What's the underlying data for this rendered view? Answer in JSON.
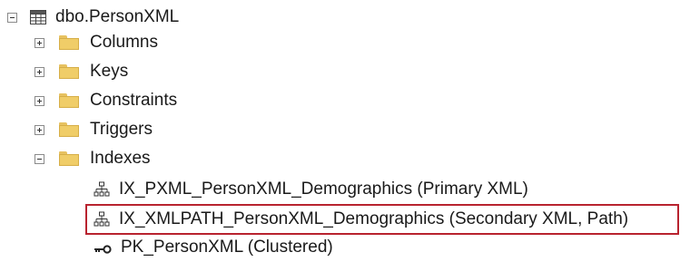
{
  "tree": {
    "table": {
      "label": "dbo.PersonXML",
      "icon": "table-icon"
    },
    "folders": [
      {
        "label": "Columns",
        "expanded": false
      },
      {
        "label": "Keys",
        "expanded": false
      },
      {
        "label": "Constraints",
        "expanded": false
      },
      {
        "label": "Triggers",
        "expanded": false
      },
      {
        "label": "Indexes",
        "expanded": true
      }
    ],
    "indexes": [
      {
        "label": "IX_PXML_PersonXML_Demographics (Primary XML)",
        "icon": "index-icon"
      },
      {
        "label": "IX_XMLPATH_PersonXML_Demographics (Secondary XML, Path)",
        "icon": "index-icon",
        "highlighted": true
      },
      {
        "label": "PK_PersonXML (Clustered)",
        "icon": "key-icon"
      }
    ]
  },
  "colors": {
    "highlight_border": "#b8232f",
    "folder": "#f0cd68"
  }
}
